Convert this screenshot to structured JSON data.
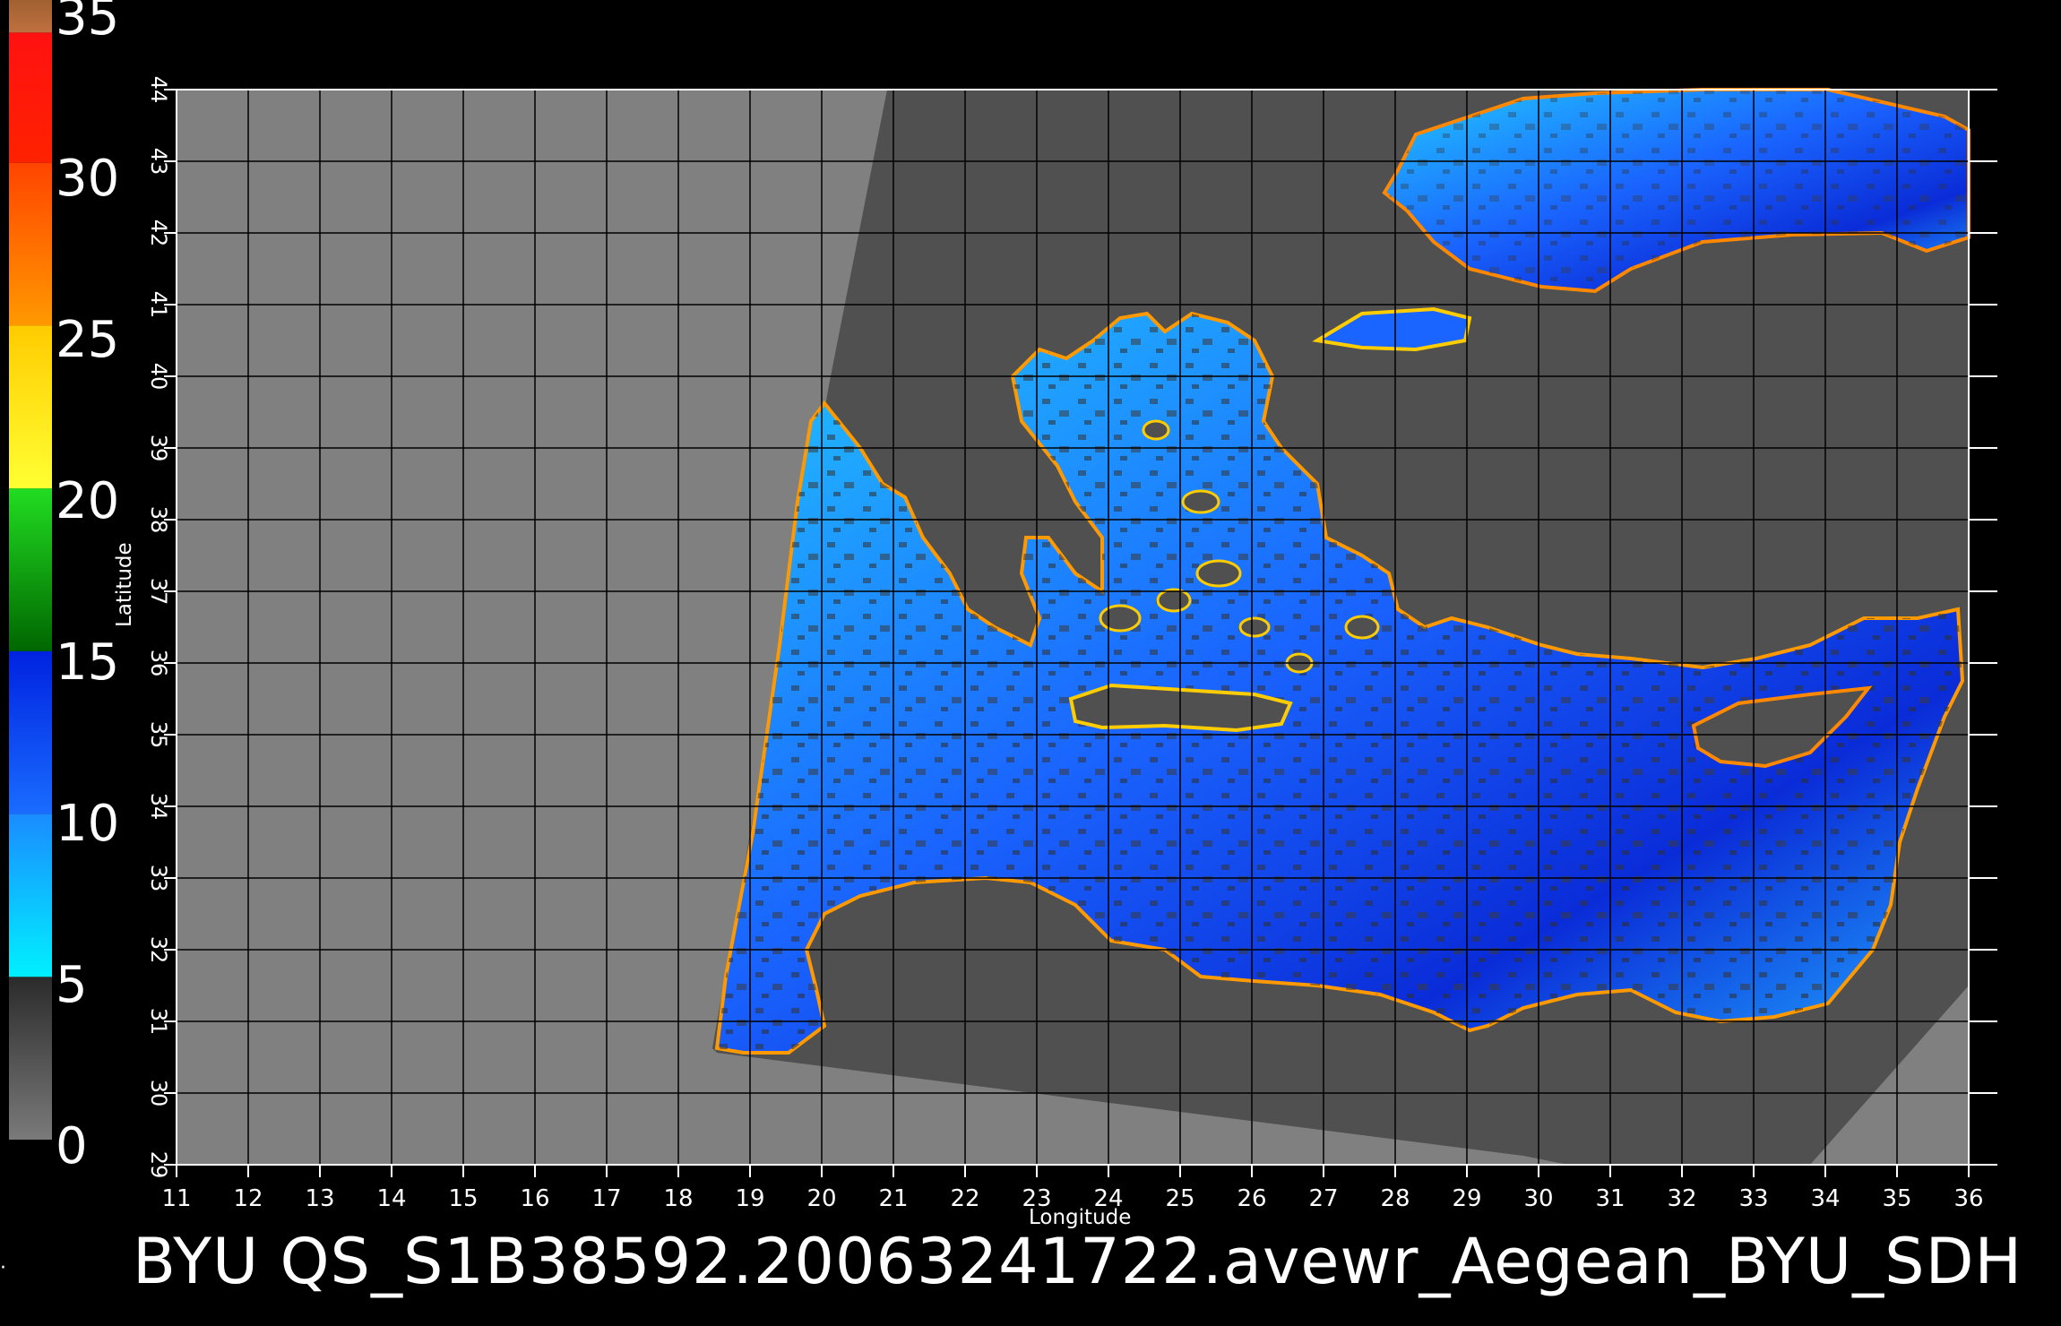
{
  "product": "BYU",
  "file_name": "QS_S1B38592.2006324172​2.avewr_Aegean_BYU_SDH",
  "caption_text": "BYU  QS_S1B38592.20063241722.avewr_Aegean_BYU_SDH",
  "axes": {
    "xlabel": "Longitude",
    "ylabel": "Latitude",
    "lon_ticks": [
      "11",
      "12",
      "13",
      "14",
      "15",
      "16",
      "17",
      "18",
      "19",
      "20",
      "21",
      "22",
      "23",
      "24",
      "25",
      "26",
      "27",
      "28",
      "29",
      "30",
      "31",
      "32",
      "33",
      "34",
      "35",
      "36"
    ],
    "lat_ticks": [
      "29",
      "30",
      "31",
      "32",
      "33",
      "34",
      "35",
      "36",
      "37",
      "38",
      "39",
      "40",
      "41",
      "42",
      "43",
      "44"
    ],
    "lon_range": [
      11,
      36
    ],
    "lat_range": [
      29,
      44
    ]
  },
  "colorbar": {
    "labels": [
      "35",
      "30",
      "25",
      "20",
      "15",
      "10",
      "5",
      "0"
    ],
    "range": [
      0,
      35
    ],
    "segments": [
      {
        "from": 0,
        "to": 5,
        "colors": [
          "#7a7a7a",
          "#2b2b2b"
        ]
      },
      {
        "from": 5,
        "to": 10,
        "colors": [
          "#00f0ff",
          "#1a8cff"
        ]
      },
      {
        "from": 10,
        "to": 15,
        "colors": [
          "#1a6cff",
          "#0022e0"
        ]
      },
      {
        "from": 15,
        "to": 20,
        "colors": [
          "#006600",
          "#22dd22"
        ]
      },
      {
        "from": 20,
        "to": 25,
        "colors": [
          "#ffff33",
          "#ffcc00"
        ]
      },
      {
        "from": 25,
        "to": 30,
        "colors": [
          "#ff9900",
          "#ff4400"
        ]
      },
      {
        "from": 30,
        "to": 34,
        "colors": [
          "#ff2200",
          "#ff1111"
        ]
      },
      {
        "from": 34,
        "to": 35,
        "colors": [
          "#c07040",
          "#a06030"
        ]
      }
    ]
  },
  "colors": {
    "background": "#000000",
    "outside_swath": "#808080",
    "land_in_swath": "#505050",
    "grid": "#000000",
    "sea_low": "#22c8ff",
    "sea_mid": "#1a64ff",
    "sea_high": "#0a2cd8"
  }
}
